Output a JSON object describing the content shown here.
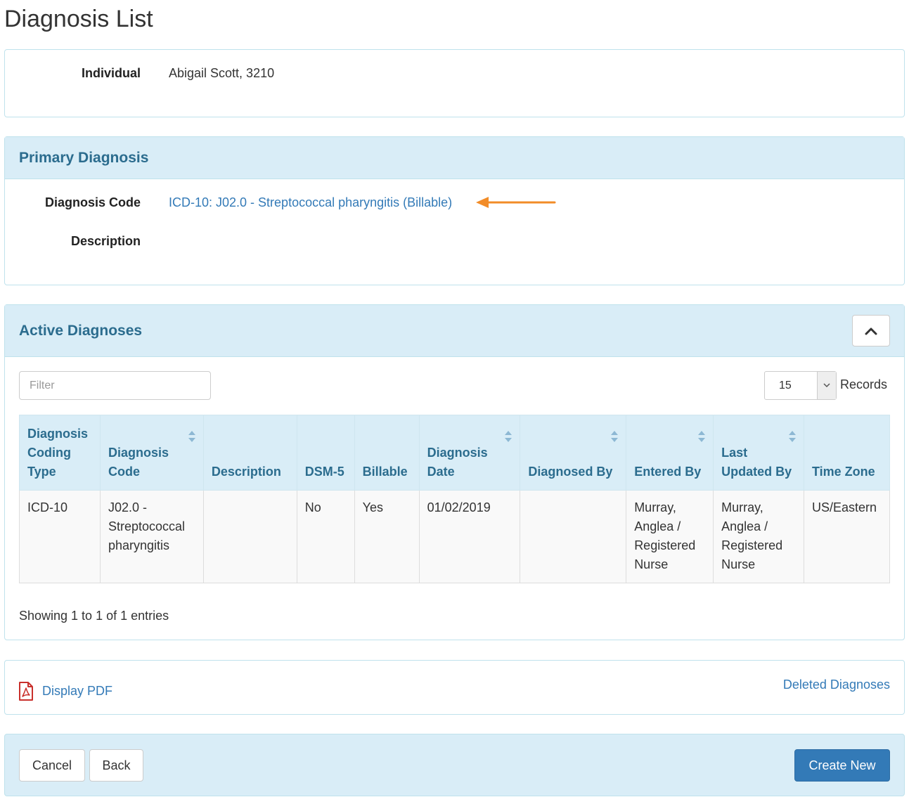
{
  "page": {
    "title": "Diagnosis List"
  },
  "individual": {
    "label": "Individual",
    "value": "Abigail Scott, 3210"
  },
  "primary": {
    "heading": "Primary Diagnosis",
    "code_label": "Diagnosis Code",
    "code_value": "ICD-10: J02.0 - Streptococcal pharyngitis (Billable)",
    "description_label": "Description",
    "description_value": ""
  },
  "active": {
    "heading": "Active Diagnoses",
    "filter_placeholder": "Filter",
    "records_value": "15",
    "records_label": "Records",
    "columns": [
      {
        "label": "Diagnosis Coding Type",
        "sortable": false
      },
      {
        "label": "Diagnosis Code",
        "sortable": true
      },
      {
        "label": "Description",
        "sortable": false
      },
      {
        "label": "DSM-5",
        "sortable": false
      },
      {
        "label": "Billable",
        "sortable": false
      },
      {
        "label": "Diagnosis Date",
        "sortable": true
      },
      {
        "label": "Diagnosed By",
        "sortable": true
      },
      {
        "label": "Entered By",
        "sortable": true
      },
      {
        "label": "Last Updated By",
        "sortable": true
      },
      {
        "label": "Time Zone",
        "sortable": false
      }
    ],
    "rows": [
      [
        "ICD-10",
        "J02.0 - Streptococcal pharyngitis",
        "",
        "No",
        "Yes",
        "01/02/2019",
        "",
        "Murray, Anglea / Registered Nurse",
        "Murray, Anglea / Registered Nurse",
        "US/Eastern"
      ]
    ],
    "showing": "Showing 1 to 1 of 1 entries"
  },
  "links": {
    "pdf": "Display PDF",
    "deleted": "Deleted Diagnoses"
  },
  "actions": {
    "cancel": "Cancel",
    "back": "Back",
    "create": "Create New"
  },
  "colors": {
    "accent": "#337ab7",
    "panel_heading": "#d9edf7",
    "heading_text": "#2b6c8e",
    "annotation_arrow": "#f28c28",
    "pdf_icon": "#c9302c"
  }
}
